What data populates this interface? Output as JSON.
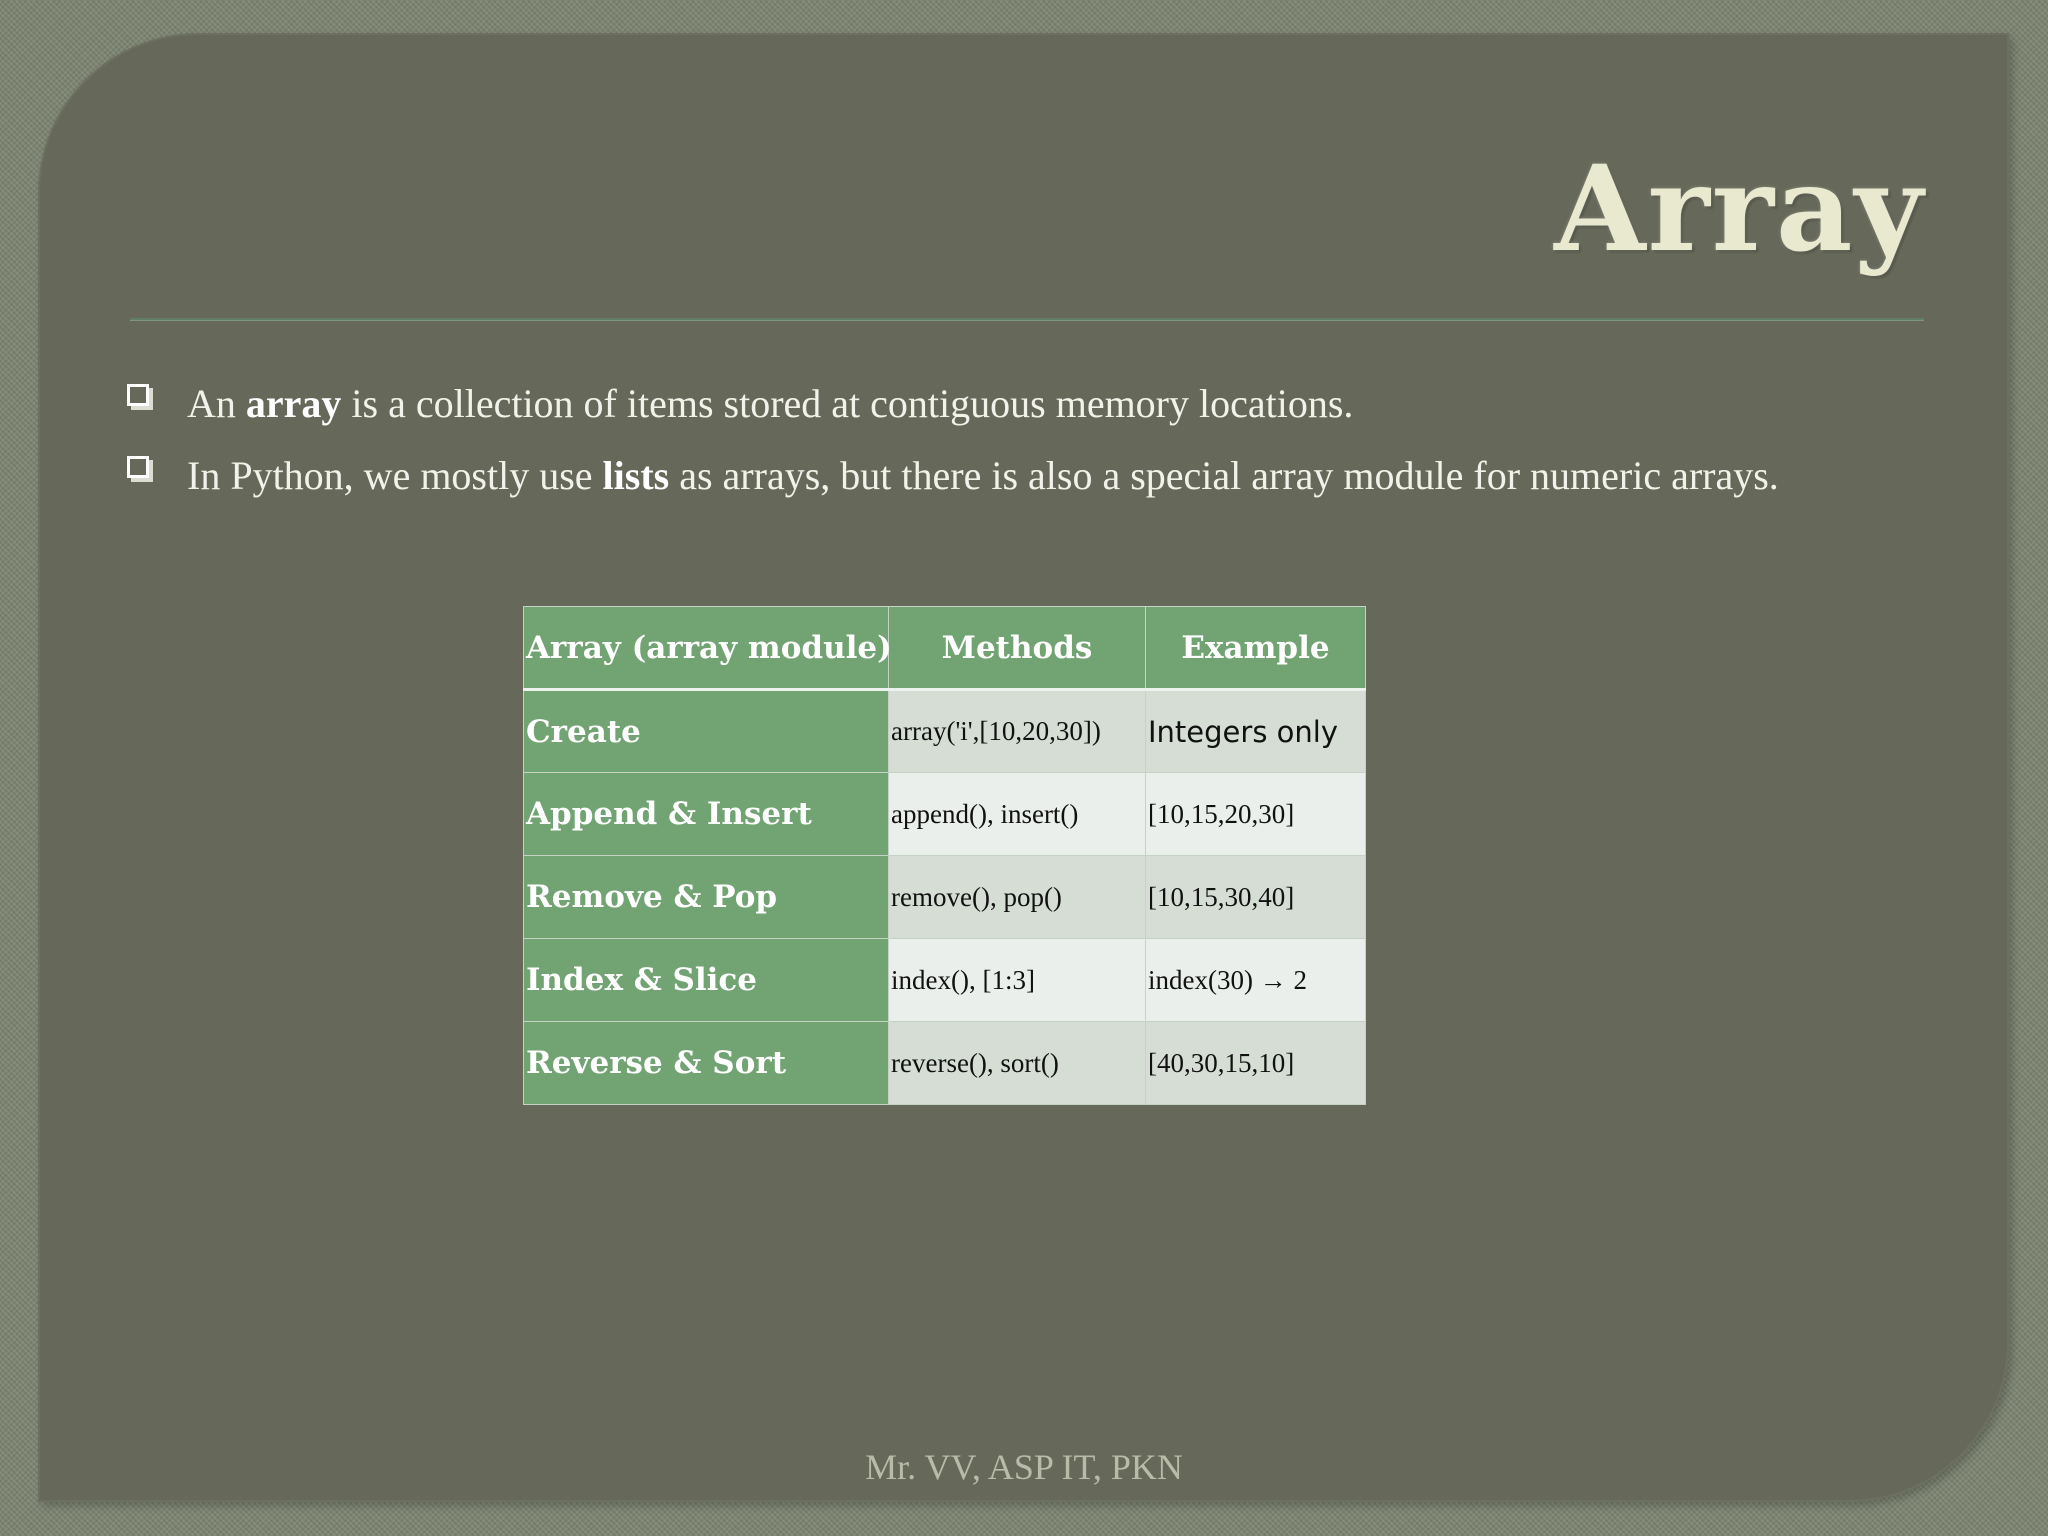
{
  "slide": {
    "title": "Array",
    "bullets": [
      {
        "before": "An ",
        "bold": "array",
        "after": " is a collection of items stored at contiguous memory locations."
      },
      {
        "before": "In Python, we mostly use ",
        "bold": "lists",
        "after": " as arrays, but there is also a special array module for numeric arrays."
      }
    ],
    "table": {
      "headers": [
        "Array (array module)",
        "Methods",
        "Example"
      ],
      "rows": [
        {
          "label": "Create",
          "method": "array('i',[10,20,30])",
          "example": "Integers only"
        },
        {
          "label": "Append & Insert",
          "method": "append(), insert()",
          "example": "[10,15,20,30]"
        },
        {
          "label": "Remove & Pop",
          "method": "remove(), pop()",
          "example": "[10,15,30,40]"
        },
        {
          "label": "Index & Slice",
          "method": "index(), [1:3]",
          "example": "index(30) → 2"
        },
        {
          "label": "Reverse & Sort",
          "method": "reverse(), sort()",
          "example": "[40,30,15,10]"
        }
      ]
    },
    "footer": "Mr. VV, ASP IT, PKN"
  },
  "colors": {
    "background": "#7c8370",
    "panel": "#666959",
    "title": "#e8e9cf",
    "table_header": "#72a373",
    "row_light": "#ebefeb",
    "row_dark": "#d5ddd5"
  },
  "icons": {
    "bullet": "hollow-square-bullet-icon"
  }
}
